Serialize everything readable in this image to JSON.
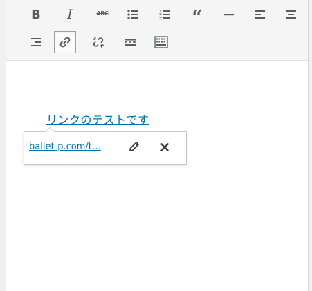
{
  "toolbar": {
    "row1": [
      {
        "name": "bold-button",
        "label": "B"
      },
      {
        "name": "italic-button",
        "label": "I"
      },
      {
        "name": "strikethrough-button",
        "label": "ABC"
      },
      {
        "name": "bulleted-list-button",
        "icon": "bulleted-list-icon"
      },
      {
        "name": "numbered-list-button",
        "icon": "numbered-list-icon"
      },
      {
        "name": "blockquote-button",
        "label": "“"
      },
      {
        "name": "horizontal-line-button",
        "icon": "horizontal-line-icon"
      },
      {
        "name": "align-left-button",
        "icon": "align-left-icon"
      },
      {
        "name": "align-center-button",
        "icon": "align-center-icon"
      }
    ],
    "row2": [
      {
        "name": "align-right-button",
        "icon": "align-right-icon"
      },
      {
        "name": "insert-link-button",
        "icon": "link-icon",
        "active": true
      },
      {
        "name": "remove-link-button",
        "icon": "unlink-icon"
      },
      {
        "name": "read-more-button",
        "icon": "read-more-icon"
      },
      {
        "name": "toolbar-toggle-button",
        "icon": "keyboard-icon"
      }
    ]
  },
  "content": {
    "link_text": "リンクのテストです"
  },
  "link_popup": {
    "url_display": "ballet-p.com/t…",
    "edit_icon": "pencil-icon",
    "remove_icon": "close-icon"
  },
  "colors": {
    "link": "#0073aa",
    "icon": "#555d66",
    "toolbar_bg": "#f5f5f5",
    "page_bg": "#f1f1f1"
  }
}
